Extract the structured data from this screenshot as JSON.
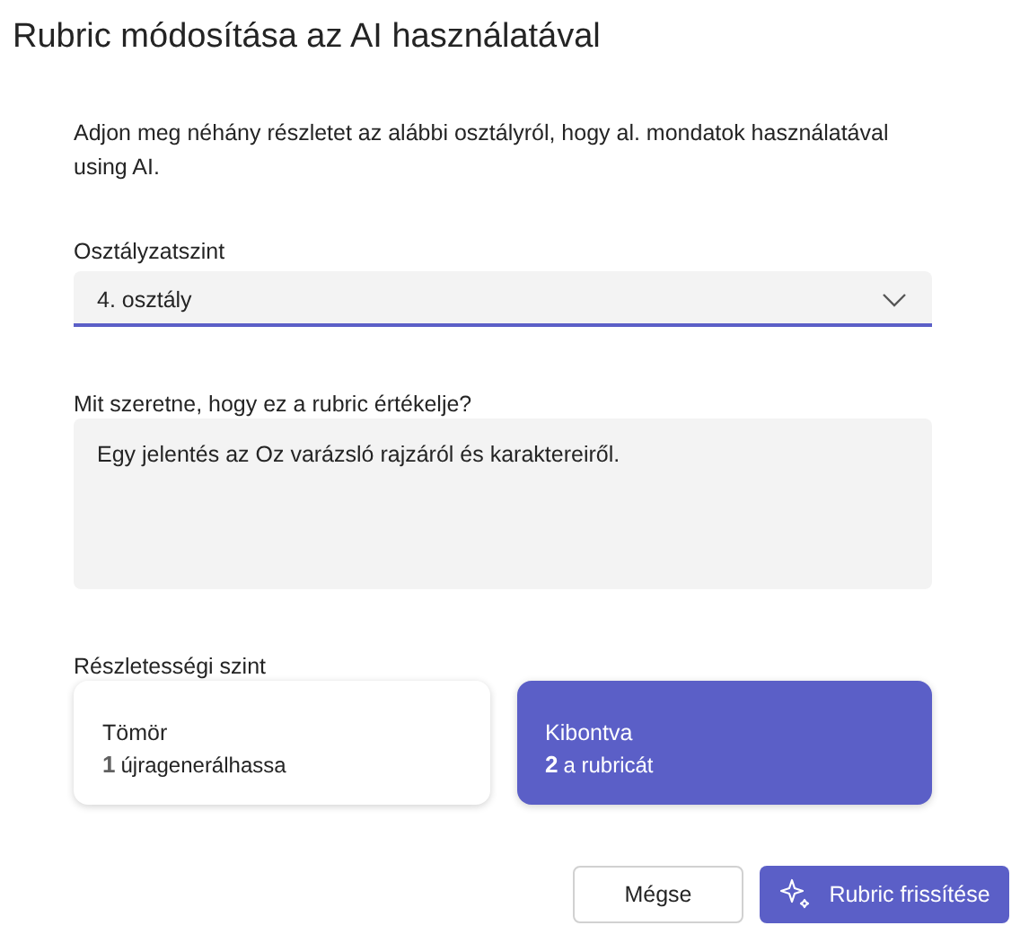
{
  "dialog": {
    "title": "Rubric módosítása az AI használatával"
  },
  "description": "Adjon meg néhány részletet az alábbi osztályról, hogy al. mondatok használatával using AI.",
  "grade_field": {
    "label": "Osztályzatszint",
    "value": "4. osztály"
  },
  "goal_field": {
    "label": "Mit szeretne, hogy ez a rubric értékelje?",
    "value": "Egy jelentés az Oz varázsló rajzáról és karaktereiről."
  },
  "detail_level": {
    "label": "Részletességi szint",
    "options": [
      {
        "title": "Tömör",
        "number": "1",
        "text": "újragenerálhassa",
        "selected": false
      },
      {
        "title": "Kibontva",
        "number": "2",
        "text": "a rubricát",
        "selected": true
      }
    ]
  },
  "buttons": [
    {
      "label": "Mégse",
      "kind": "secondary"
    },
    {
      "label": "Rubric frissítése",
      "kind": "primary"
    }
  ]
}
